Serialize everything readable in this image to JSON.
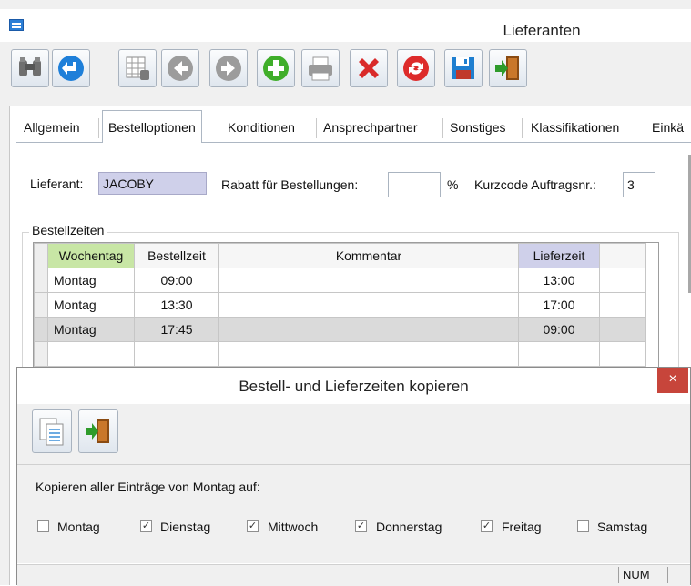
{
  "main_window": {
    "title": "Lieferanten"
  },
  "toolbar": {
    "buttons": [
      {
        "name": "binoculars-icon",
        "tooltip": ""
      },
      {
        "name": "back-arrow-icon",
        "tooltip": ""
      },
      {
        "name": "grid-list-icon",
        "tooltip": ""
      },
      {
        "name": "previous-icon",
        "tooltip": ""
      },
      {
        "name": "next-icon",
        "tooltip": ""
      },
      {
        "name": "add-icon",
        "tooltip": ""
      },
      {
        "name": "print-icon",
        "tooltip": ""
      },
      {
        "name": "delete-icon",
        "tooltip": ""
      },
      {
        "name": "refresh-icon",
        "tooltip": ""
      },
      {
        "name": "save-icon",
        "tooltip": ""
      },
      {
        "name": "exit-door-icon",
        "tooltip": ""
      }
    ]
  },
  "tabs": [
    {
      "label": "Allgemein",
      "active": false
    },
    {
      "label": "Bestelloptionen",
      "active": true
    },
    {
      "label": "Konditionen",
      "active": false
    },
    {
      "label": "Ansprechpartner",
      "active": false
    },
    {
      "label": "Sonstiges",
      "active": false
    },
    {
      "label": "Klassifikationen",
      "active": false
    },
    {
      "label": "Einkä",
      "active": false
    }
  ],
  "form": {
    "lieferant_label": "Lieferant:",
    "lieferant_value": "JACOBY",
    "rabatt_label": "Rabatt für Bestellungen:",
    "rabatt_value": "",
    "percent_sign": "%",
    "kurzcode_label": "Kurzcode Auftragsnr.:",
    "kurzcode_value": "3"
  },
  "bestellzeiten": {
    "group_title": "Bestellzeiten",
    "columns": [
      "Wochentag",
      "Bestellzeit",
      "Kommentar",
      "Lieferzeit"
    ],
    "rows": [
      {
        "wochentag": "Montag",
        "bestellzeit": "09:00",
        "kommentar": "",
        "lieferzeit": "13:00",
        "selected": false
      },
      {
        "wochentag": "Montag",
        "bestellzeit": "13:30",
        "kommentar": "",
        "lieferzeit": "17:00",
        "selected": false
      },
      {
        "wochentag": "Montag",
        "bestellzeit": "17:45",
        "kommentar": "",
        "lieferzeit": "09:00",
        "selected": true
      },
      {
        "wochentag": "",
        "bestellzeit": "",
        "kommentar": "",
        "lieferzeit": "",
        "selected": false
      }
    ]
  },
  "dialog": {
    "title": "Bestell- und Lieferzeiten kopieren",
    "close_glyph": "×",
    "instruction": "Kopieren aller Einträge von Montag auf:",
    "days": [
      {
        "label": "Montag",
        "checked": false
      },
      {
        "label": "Dienstag",
        "checked": true
      },
      {
        "label": "Mittwoch",
        "checked": true
      },
      {
        "label": "Donnerstag",
        "checked": true
      },
      {
        "label": "Freitag",
        "checked": true
      },
      {
        "label": "Samstag",
        "checked": false
      }
    ],
    "status_num": "NUM"
  },
  "colors": {
    "wochentag_header": "#c8e6a5",
    "lieferzeit_header": "#cfd0ea",
    "close_button": "#c7453b",
    "selected_row": "#dadada"
  }
}
